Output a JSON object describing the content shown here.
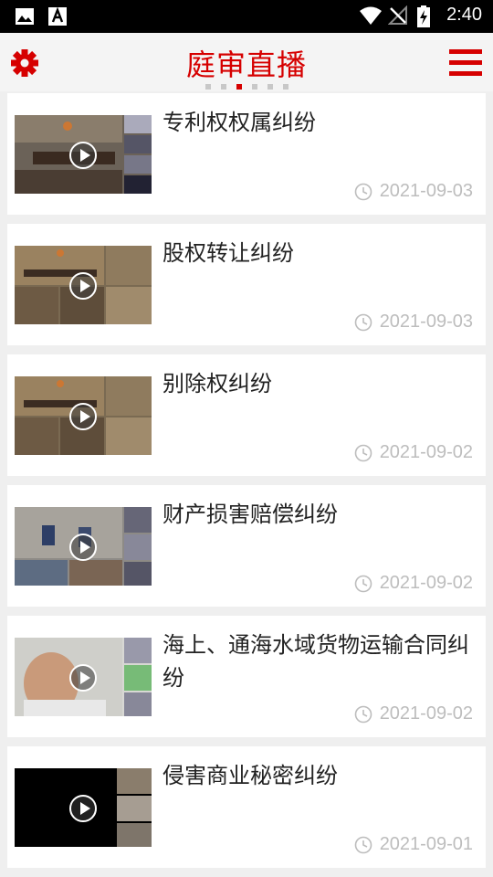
{
  "status_bar": {
    "time": "2:40",
    "left_icons": [
      "image-icon",
      "a-letter-icon"
    ],
    "right_icons": [
      "wifi-icon",
      "no-signal-icon",
      "battery-charging-icon"
    ]
  },
  "header": {
    "title": "庭审直播",
    "settings_icon": "gear-icon",
    "menu_icon": "menu-icon",
    "pager_count": 6,
    "pager_active": 3,
    "accent_color": "#d60000"
  },
  "items": [
    {
      "title": "专利权权属纠纷",
      "date": "2021-09-03"
    },
    {
      "title": "股权转让纠纷",
      "date": "2021-09-03"
    },
    {
      "title": "别除权纠纷",
      "date": "2021-09-02"
    },
    {
      "title": "财产损害赔偿纠纷",
      "date": "2021-09-02"
    },
    {
      "title": "海上、通海水域货物运输合同纠纷",
      "date": "2021-09-02"
    },
    {
      "title": "侵害商业秘密纠纷",
      "date": "2021-09-01"
    }
  ]
}
